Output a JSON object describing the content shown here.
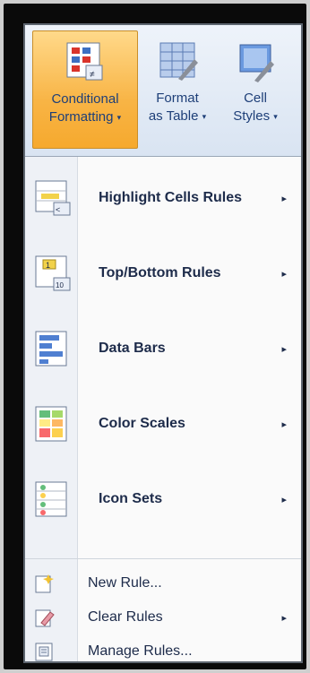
{
  "ribbon": {
    "buttons": [
      {
        "name": "conditional-formatting",
        "line1": "Conditional",
        "line2": "Formatting",
        "caret": "▾"
      },
      {
        "name": "format-as-table",
        "line1": "Format",
        "line2": "as Table",
        "caret": "▾"
      },
      {
        "name": "cell-styles",
        "line1": "Cell",
        "line2": "Styles",
        "caret": "▾"
      }
    ]
  },
  "menu": {
    "items": [
      {
        "label": "Highlight Cells Rules",
        "icon": "highlight-cells-icon",
        "submenu": "▸"
      },
      {
        "label": "Top/Bottom Rules",
        "icon": "top-bottom-icon",
        "submenu": "▸"
      },
      {
        "label": "Data Bars",
        "icon": "data-bars-icon",
        "submenu": "▸"
      },
      {
        "label": "Color Scales",
        "icon": "color-scales-icon",
        "submenu": "▸"
      },
      {
        "label": "Icon Sets",
        "icon": "icon-sets-icon",
        "submenu": "▸"
      }
    ],
    "commands": [
      {
        "label": "New Rule...",
        "icon": "new-rule-icon",
        "submenu": ""
      },
      {
        "label": "Clear Rules",
        "icon": "clear-rules-icon",
        "submenu": "▸"
      },
      {
        "label": "Manage Rules...",
        "icon": "manage-rules-icon",
        "submenu": ""
      }
    ]
  },
  "colors": {
    "accent": "#f8b445",
    "text": "#1d2b4a",
    "ribbon_text": "#1e3f78"
  }
}
